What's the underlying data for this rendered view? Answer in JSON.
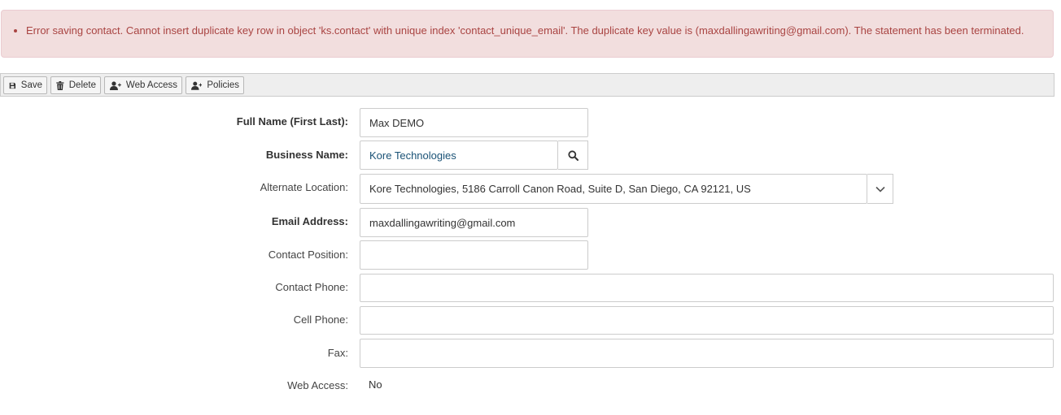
{
  "alert": {
    "message": "Error saving contact. Cannot insert duplicate key row in object 'ks.contact' with unique index 'contact_unique_email'. The duplicate key value is (maxdallingawriting@gmail.com). The statement has been terminated."
  },
  "toolbar": {
    "save_label": "Save",
    "delete_label": "Delete",
    "web_access_label": "Web Access",
    "policies_label": "Policies"
  },
  "form": {
    "full_name_label": "Full Name (First Last):",
    "full_name_value": "Max DEMO",
    "business_name_label": "Business Name:",
    "business_name_value": "Kore Technologies",
    "alternate_location_label": "Alternate Location:",
    "alternate_location_value": "Kore Technologies, 5186 Carroll Canon Road, Suite D, San Diego, CA  92121, US",
    "email_label": "Email Address:",
    "email_value": "maxdallingawriting@gmail.com",
    "contact_position_label": "Contact Position:",
    "contact_position_value": "",
    "contact_phone_label": "Contact Phone:",
    "contact_phone_value": "",
    "cell_phone_label": "Cell Phone:",
    "cell_phone_value": "",
    "fax_label": "Fax:",
    "fax_value": "",
    "web_access_label": "Web Access:",
    "web_access_value": "No"
  },
  "icons": {
    "save": "floppy-disk-icon",
    "delete": "trash-icon",
    "web_access": "user-plus-icon",
    "policies": "user-plus-icon",
    "business_search": "search-icon",
    "location_dropdown": "chevron-down-icon"
  },
  "colors": {
    "alert_bg": "#f2dede",
    "alert_text": "#a94442",
    "toolbar_bg": "#eeeeee",
    "link_text": "#1a5276"
  }
}
